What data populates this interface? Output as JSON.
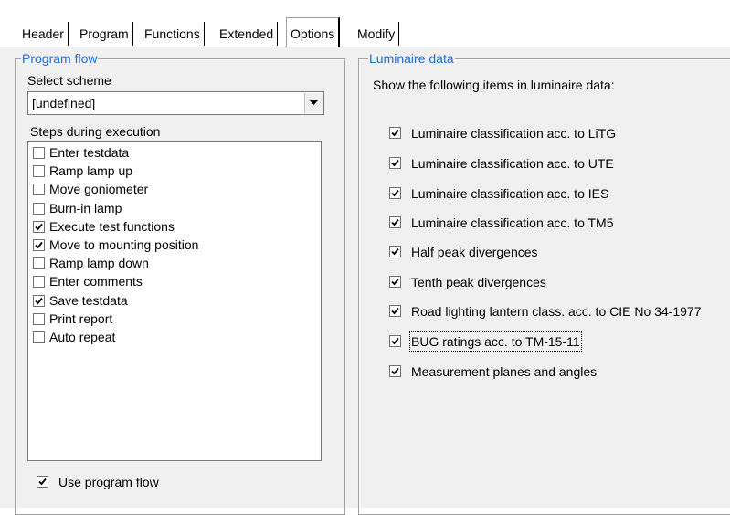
{
  "tabs": [
    {
      "label": "Header",
      "active": false
    },
    {
      "label": "Program",
      "active": false
    },
    {
      "label": "Functions",
      "active": false
    },
    {
      "label": "Extended",
      "active": false
    },
    {
      "label": "Options",
      "active": true
    },
    {
      "label": "Modify",
      "active": false
    }
  ],
  "program_flow": {
    "legend": "Program flow",
    "select_scheme_label": "Select scheme",
    "scheme_value": "[undefined]",
    "steps_label": "Steps during execution",
    "steps": [
      {
        "label": "Enter testdata",
        "checked": false
      },
      {
        "label": "Ramp lamp up",
        "checked": false
      },
      {
        "label": "Move goniometer",
        "checked": false
      },
      {
        "label": "Burn-in lamp",
        "checked": false
      },
      {
        "label": "Execute test functions",
        "checked": true
      },
      {
        "label": "Move to mounting position",
        "checked": true
      },
      {
        "label": "Ramp lamp down",
        "checked": false
      },
      {
        "label": "Enter comments",
        "checked": false
      },
      {
        "label": "Save testdata",
        "checked": true
      },
      {
        "label": "Print report",
        "checked": false
      },
      {
        "label": "Auto repeat",
        "checked": false
      }
    ],
    "use_program_flow": {
      "label": "Use program flow",
      "checked": true
    }
  },
  "luminaire_data": {
    "legend": "Luminaire data",
    "intro": "Show the following items in luminaire data:",
    "items": [
      {
        "label": "Luminaire classification acc. to LiTG",
        "checked": true
      },
      {
        "label": "Luminaire classification acc. to UTE",
        "checked": true
      },
      {
        "label": "Luminaire classification acc. to IES",
        "checked": true
      },
      {
        "label": "Luminaire classification acc. to TM5",
        "checked": true
      },
      {
        "label": "Half peak divergences",
        "checked": true
      },
      {
        "label": "Tenth peak divergences",
        "checked": true
      },
      {
        "label": "Road lighting lantern class. acc. to CIE No 34-1977",
        "checked": true
      },
      {
        "label": "BUG ratings acc. to TM-15-11",
        "checked": true
      },
      {
        "label": "Measurement planes and angles",
        "checked": true
      }
    ]
  },
  "colors": {
    "legend": "#1e6fd6",
    "panel": "#f0f0f0"
  }
}
